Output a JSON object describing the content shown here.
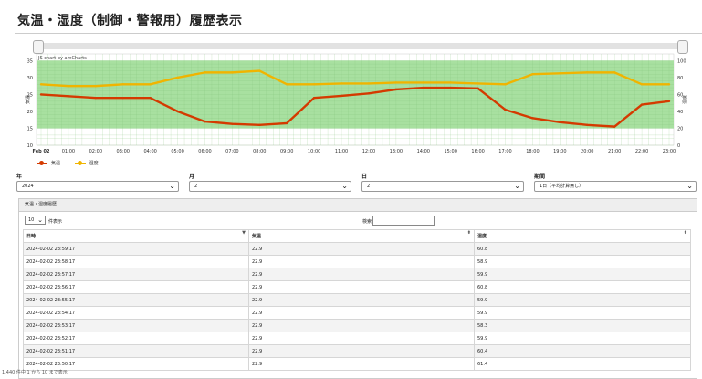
{
  "page": {
    "title": "気温・湿度（制御・警報用）履歴表示"
  },
  "chart_data": {
    "type": "line",
    "credit": "JS chart by amCharts",
    "x": [
      "00:00",
      "01:00",
      "02:00",
      "03:00",
      "04:00",
      "05:00",
      "06:00",
      "07:00",
      "08:00",
      "09:00",
      "10:00",
      "11:00",
      "12:00",
      "13:00",
      "14:00",
      "15:00",
      "16:00",
      "17:00",
      "18:00",
      "19:00",
      "20:00",
      "21:00",
      "22:00",
      "23:00"
    ],
    "first_x_label": "Feb 02",
    "yleft": {
      "label": "気温",
      "ticks": [
        10,
        15,
        20,
        25,
        30,
        35
      ],
      "range": [
        10,
        37
      ]
    },
    "yright": {
      "label": "湿度",
      "ticks": [
        0,
        20,
        40,
        60,
        80,
        100
      ],
      "range": [
        0,
        108
      ]
    },
    "series": [
      {
        "name": "気温",
        "color": "#d43a00",
        "axis": "left",
        "values": [
          25,
          24.5,
          24,
          24,
          24,
          20,
          17,
          16.3,
          16,
          16.5,
          24,
          24.6,
          25.3,
          26.5,
          27,
          27,
          26.8,
          20.5,
          18,
          16.8,
          16,
          15.5,
          22,
          23
        ]
      },
      {
        "name": "湿度",
        "color": "#f0b400",
        "axis": "right",
        "values": [
          72,
          70,
          70,
          72,
          72,
          80,
          86,
          86,
          88,
          72,
          72,
          73,
          73,
          74,
          74,
          74,
          73,
          72,
          84,
          85,
          86,
          86,
          72,
          72
        ]
      }
    ],
    "bands": [
      {
        "from": 15,
        "to": 35,
        "axis": "left",
        "color": "#a8e0a0"
      }
    ],
    "grid": true,
    "legend": "bottom-left"
  },
  "filters": {
    "year": {
      "label": "年",
      "value": "2024"
    },
    "month": {
      "label": "月",
      "value": "2"
    },
    "day": {
      "label": "日",
      "value": "2"
    },
    "period": {
      "label": "期間",
      "value": "1日（平均計算無し）"
    }
  },
  "history": {
    "panel_title": "気温・湿度履歴",
    "length_value": "10",
    "length_text": "件表示",
    "search_label": "検索:",
    "columns": [
      "日時",
      "気温",
      "湿度"
    ],
    "rows": [
      [
        "2024-02-02 23:59:17",
        "22.9",
        "60.8"
      ],
      [
        "2024-02-02 23:58:17",
        "22.9",
        "58.9"
      ],
      [
        "2024-02-02 23:57:17",
        "22.9",
        "59.9"
      ],
      [
        "2024-02-02 23:56:17",
        "22.9",
        "60.8"
      ],
      [
        "2024-02-02 23:55:17",
        "22.9",
        "59.9"
      ],
      [
        "2024-02-02 23:54:17",
        "22.9",
        "59.9"
      ],
      [
        "2024-02-02 23:53:17",
        "22.9",
        "58.3"
      ],
      [
        "2024-02-02 23:52:17",
        "22.9",
        "59.9"
      ],
      [
        "2024-02-02 23:51:17",
        "22.9",
        "60.4"
      ],
      [
        "2024-02-02 23:50:17",
        "22.9",
        "61.4"
      ]
    ],
    "info": "1,440 件中 1 から 10 まで表示"
  }
}
